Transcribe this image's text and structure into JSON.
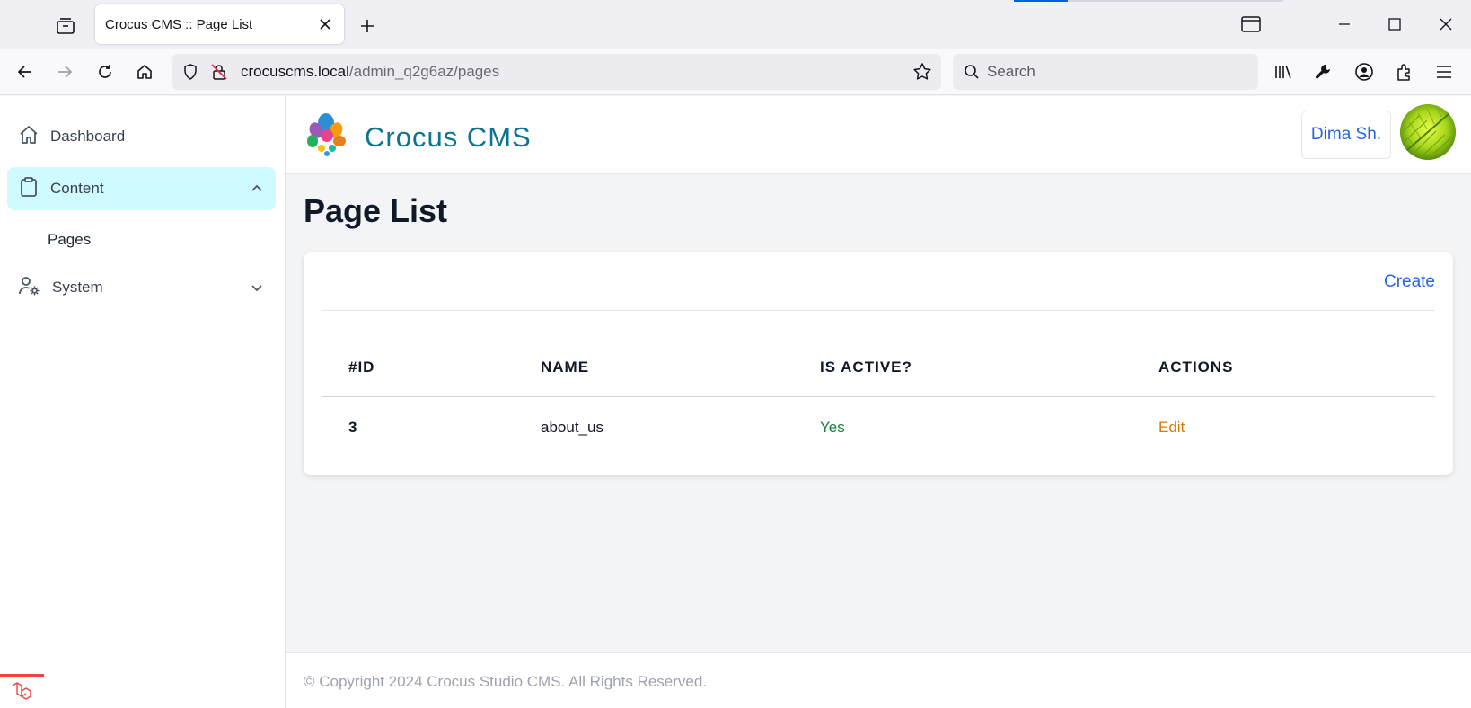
{
  "browser": {
    "tab_title": "Crocus CMS :: Page List",
    "url_host": "crocuscms.local",
    "url_path": "/admin_q2g6az/pages",
    "search_placeholder": "Search"
  },
  "sidebar": {
    "items": [
      {
        "label": "Dashboard",
        "icon": "home-icon"
      },
      {
        "label": "Content",
        "icon": "clipboard-icon",
        "expanded": true
      },
      {
        "label": "System",
        "icon": "user-gear-icon",
        "expanded": false
      }
    ],
    "sub_items": [
      {
        "label": "Pages"
      }
    ]
  },
  "header": {
    "brand": "Crocus CMS",
    "user_name": "Dima Sh."
  },
  "main": {
    "title": "Page List",
    "create_label": "Create",
    "table": {
      "columns": [
        "#ID",
        "NAME",
        "IS ACTIVE?",
        "ACTIONS"
      ],
      "rows": [
        {
          "id": "3",
          "name": "about_us",
          "active": "Yes",
          "action": "Edit"
        }
      ]
    }
  },
  "footer": {
    "text": "© Copyright 2024 Crocus Studio CMS. All Rights Reserved."
  },
  "colors": {
    "accent": "#0e7490",
    "active_nav": "#cffafe",
    "link": "#2563eb",
    "yes": "#15803d",
    "edit": "#d97706"
  }
}
